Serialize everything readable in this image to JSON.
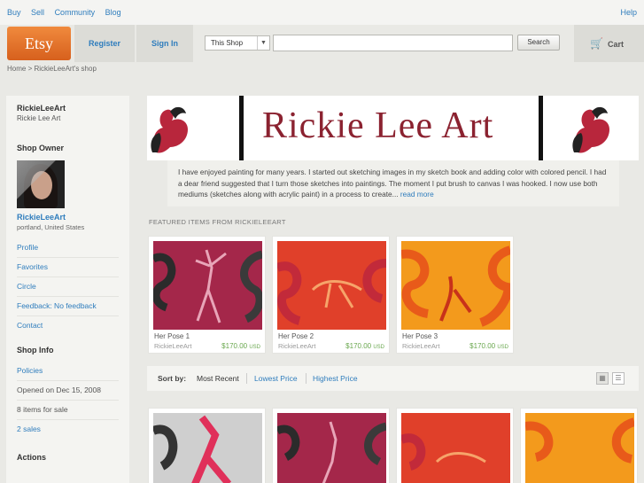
{
  "topnav": {
    "links": [
      "Buy",
      "Sell",
      "Community",
      "Blog"
    ],
    "help": "Help"
  },
  "header": {
    "logo": "Etsy",
    "register": "Register",
    "signin": "Sign In",
    "scope": "This Shop",
    "search_value": "",
    "search_button": "Search",
    "cart": "Cart"
  },
  "breadcrumb": "Home > RickieLeeArt's shop",
  "sidebar": {
    "shop_name": "RickieLeeArt",
    "shop_subtitle": "Rickie Lee Art",
    "owner_heading": "Shop Owner",
    "owner_name": "RickieLeeArt",
    "owner_location": "portland, United States",
    "owner_links": [
      "Profile",
      "Favorites",
      "Circle",
      "Feedback: No feedback",
      "Contact"
    ],
    "info_heading": "Shop Info",
    "info_policies": "Policies",
    "info_opened": "Opened on Dec 15, 2008",
    "info_items": "8 items for sale",
    "info_sales": "2 sales",
    "actions_heading": "Actions"
  },
  "banner": {
    "title": "Rickie Lee Art"
  },
  "about": {
    "text": "I have enjoyed painting for many years. I started out sketching images in my sketch book and adding color with colored pencil. I had a dear friend suggested that I turn those sketches into paintings. The moment I put brush to canvas I was hooked. I now use both mediums (sketches along with acrylic paint) in a process to create...",
    "read_more": "read more"
  },
  "featured": {
    "label": "FEATURED ITEMS FROM RICKIELEEART",
    "items": [
      {
        "name": "Her Pose 1",
        "seller": "RickieLeeArt",
        "price": "$170.00",
        "currency": "USD"
      },
      {
        "name": "Her Pose 2",
        "seller": "RickieLeeArt",
        "price": "$170.00",
        "currency": "USD"
      },
      {
        "name": "Her Pose 3",
        "seller": "RickieLeeArt",
        "price": "$170.00",
        "currency": "USD"
      }
    ]
  },
  "sort": {
    "label": "Sort by:",
    "options": [
      "Most Recent",
      "Lowest Price",
      "Highest Price"
    ]
  },
  "colors": {
    "link": "#2f7dbd",
    "brand_orange": "#e8732b",
    "price_green": "#6aa84f",
    "banner_text": "#8b2230"
  }
}
